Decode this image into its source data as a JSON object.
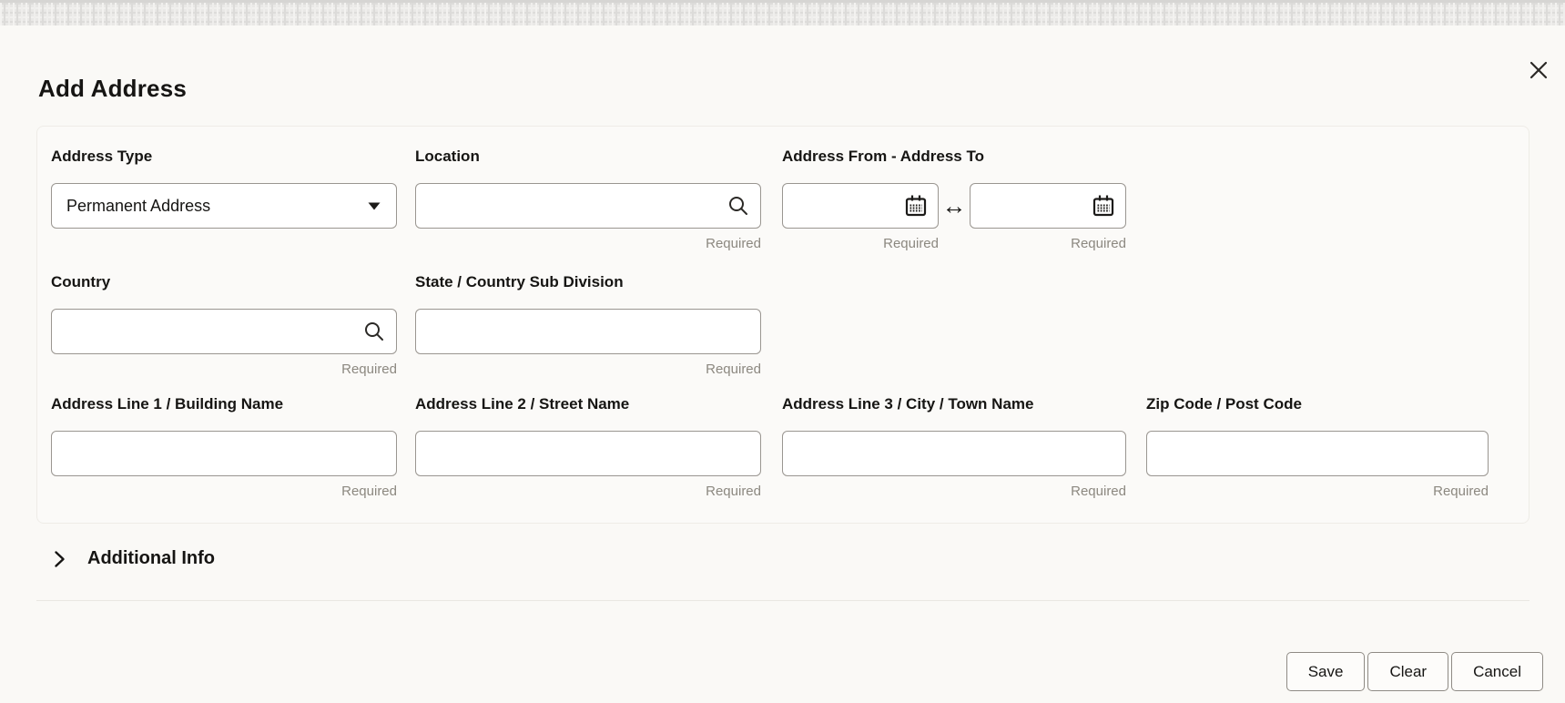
{
  "modal": {
    "title": "Add Address"
  },
  "fields": {
    "address_type": {
      "label": "Address Type",
      "value": "Permanent Address"
    },
    "location": {
      "label": "Location",
      "value": "",
      "required": "Required"
    },
    "address_from_to": {
      "label": "Address From - Address To",
      "from_value": "",
      "to_value": "",
      "required_from": "Required",
      "required_to": "Required"
    },
    "country": {
      "label": "Country",
      "value": "",
      "required": "Required"
    },
    "state": {
      "label": "State / Country Sub Division",
      "value": "",
      "required": "Required"
    },
    "address_line1": {
      "label": "Address Line 1 / Building Name",
      "value": "",
      "required": "Required"
    },
    "address_line2": {
      "label": "Address Line 2 / Street Name",
      "value": "",
      "required": "Required"
    },
    "address_line3": {
      "label": "Address Line 3 / City / Town Name",
      "value": "",
      "required": "Required"
    },
    "zip_code": {
      "label": "Zip Code / Post Code",
      "value": "",
      "required": "Required"
    }
  },
  "sections": {
    "additional_info": {
      "label": "Additional Info"
    }
  },
  "footer": {
    "save_label": "Save",
    "clear_label": "Clear",
    "cancel_label": "Cancel"
  },
  "icons": {
    "close": "close-x",
    "dropdown_caret": "caret-down",
    "search": "magnifier",
    "calendar": "calendar-grid",
    "range_arrow": "↔",
    "expand_chevron": "chevron-right"
  },
  "colors": {
    "background": "#faf9f6",
    "card_border": "#eeece7",
    "input_border": "#9a9691",
    "text": "#161513",
    "required_text": "#8c8880"
  }
}
